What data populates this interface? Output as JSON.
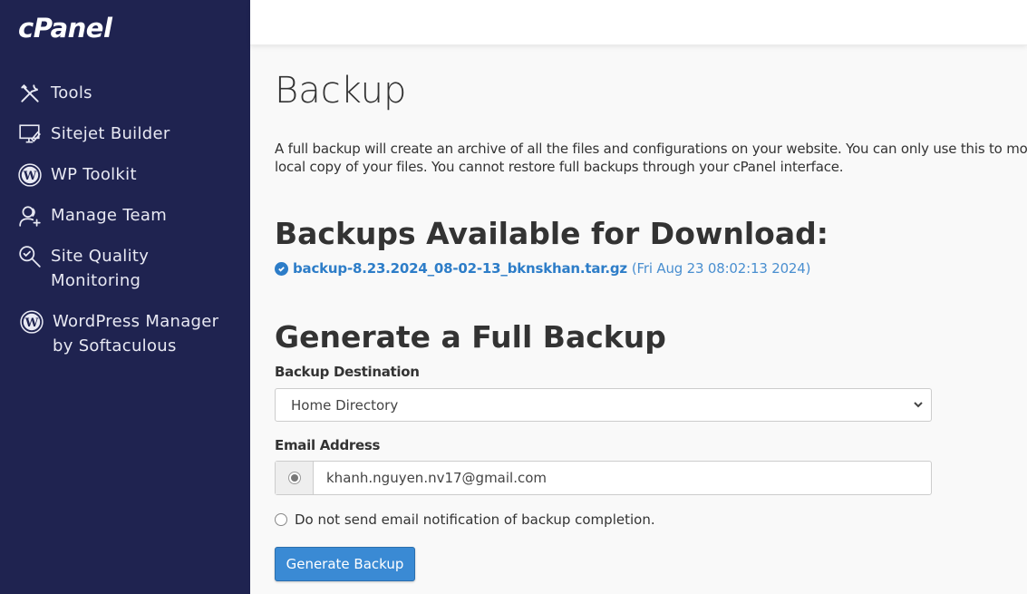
{
  "sidebar": {
    "logo": "cPanel",
    "items": [
      {
        "label": "Tools",
        "icon": "tools-icon"
      },
      {
        "label": "Sitejet Builder",
        "icon": "monitor-pen-icon"
      },
      {
        "label": "WP Toolkit",
        "icon": "wordpress-icon"
      },
      {
        "label": "Manage Team",
        "icon": "user-add-icon"
      },
      {
        "label_line1": "Site Quality",
        "label_line2": "Monitoring",
        "icon": "search-check-icon"
      },
      {
        "label_line1": "WordPress Manager",
        "label_line2": "by Softaculous",
        "icon": "wordpress-icon"
      }
    ]
  },
  "main": {
    "title": "Backup",
    "description": "A full backup will create an archive of all the files and configurations on your website. You can only use this to move your account to another server or to keep a local copy of your files. You cannot restore full backups through your cPanel interface.",
    "download_heading": "Backups Available for Download:",
    "backups": [
      {
        "filename": "backup-8.23.2024_08-02-13_bknskhan.tar.gz",
        "date": "(Fri Aug 23 08:02:13 2024)"
      }
    ],
    "generate_heading": "Generate a Full Backup",
    "destination_label": "Backup Destination",
    "destination_value": "Home Directory",
    "email_label": "Email Address",
    "email_value": "khanh.nguyen.nv17@gmail.com",
    "no_email_label": "Do not send email notification of backup completion.",
    "generate_button": "Generate Backup"
  },
  "colors": {
    "sidebar_bg": "#1f2350",
    "accent": "#3a8ad4",
    "link": "#2d7dc8"
  }
}
